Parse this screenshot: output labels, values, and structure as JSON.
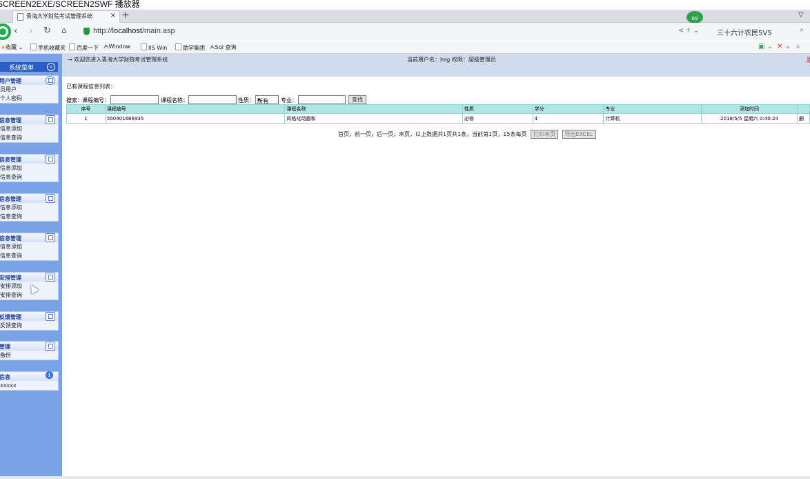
{
  "window": {
    "title": "SCREEN2EXE/SCREEN2SWF 播放器"
  },
  "browser": {
    "tab_title": "青海大学财院考试管理系统",
    "tab_close": "×",
    "new_tab": "+",
    "avatar_text": "69",
    "url_prefix": "http://",
    "url_host": "localhost",
    "url_path": "/main.asp",
    "search_text": "三十六计农民5V5",
    "bookmarks": [
      "收藏",
      "手机收藏夹",
      "百度一下",
      "Window",
      "IIS Win",
      "助学集团",
      "Sql 查询"
    ]
  },
  "sidebar": {
    "header": "系统菜单",
    "groups": [
      {
        "title": "用户管理",
        "items": [
          "员用户",
          "个人密码"
        ]
      },
      {
        "title": "信息管理",
        "items": [
          "信息添加",
          "信息查询"
        ]
      },
      {
        "title": "信息管理",
        "items": [
          "信息添加",
          "信息查询"
        ]
      },
      {
        "title": "信息管理",
        "items": [
          "信息添加",
          "信息查询"
        ]
      },
      {
        "title": "信息管理",
        "items": [
          "信息添加",
          "信息查询"
        ]
      },
      {
        "title": "安排管理",
        "items": [
          "安排添加",
          "安排查询"
        ]
      },
      {
        "title": "反馈管理",
        "items": [
          "反馈查询"
        ]
      },
      {
        "title": "管理",
        "items": [
          "备份"
        ]
      },
      {
        "title": "信息",
        "items": [
          "xxxxx"
        ]
      }
    ]
  },
  "main": {
    "welcome": "→ 欢迎您进入青海大学财院考试管理系统",
    "user_info": "当前用户名：hsg 权限：超级管理员",
    "edge_char": "退",
    "caption": "已有课程信息列表：",
    "search": {
      "label": "搜索：",
      "code_label": "课程编号：",
      "name_label": "课程名称：",
      "type_label": "性质：",
      "type_value": "所有",
      "major_label": "专业：",
      "button": "查找"
    },
    "table": {
      "headers": [
        "序号",
        "课程编号",
        "课程名称",
        "性质",
        "学分",
        "专业",
        "添加时间",
        ""
      ],
      "rows": [
        [
          "1",
          "550401666935",
          "风格化动画和",
          "必修",
          "4",
          "计算机",
          "2018/5/5 星期六 0:40:24",
          "删"
        ]
      ]
    },
    "pager": {
      "text": "首页，前一页，后一页，末页，以上数据共1页共1条，当前第1页，15条每页",
      "print_button": "打印本页",
      "export_button": "导出EXCEL"
    }
  }
}
